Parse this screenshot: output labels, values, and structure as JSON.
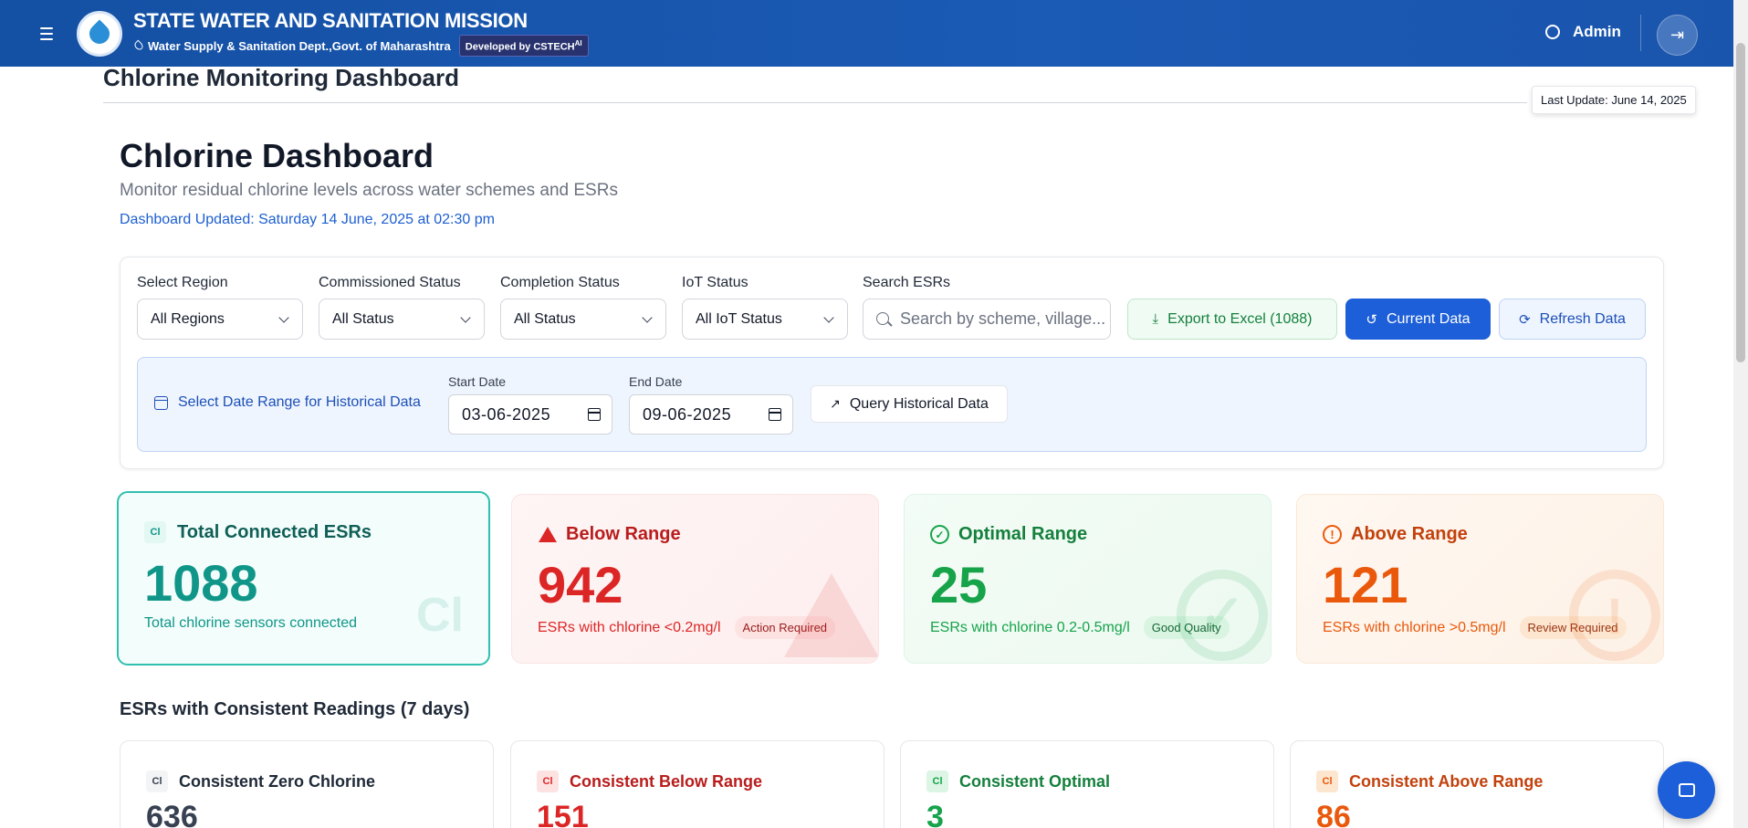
{
  "header": {
    "title": "STATE WATER AND SANITATION MISSION",
    "subtitle": "Water Supply & Sanitation Dept.,Govt. of Maharashtra",
    "developer_badge": "Developed by CSTECH",
    "developer_badge_sup": "AI",
    "admin_label": "Admin"
  },
  "page": {
    "title": "Chlorine Monitoring Dashboard",
    "last_update": "Last Update: June 14, 2025",
    "dashboard_title": "Chlorine Dashboard",
    "dashboard_subtitle": "Monitor residual chlorine levels across water schemes and ESRs",
    "dashboard_updated": "Dashboard Updated: Saturday 14 June, 2025 at 02:30 pm"
  },
  "filters": {
    "region": {
      "label": "Select Region",
      "value": "All Regions"
    },
    "commissioned": {
      "label": "Commissioned Status",
      "value": "All Status"
    },
    "completion": {
      "label": "Completion Status",
      "value": "All Status"
    },
    "iot": {
      "label": "IoT Status",
      "value": "All IoT Status"
    },
    "search": {
      "label": "Search ESRs",
      "placeholder": "Search by scheme, village..."
    },
    "export_label": "Export to Excel (1088)",
    "current_label": "Current Data",
    "refresh_label": "Refresh Data"
  },
  "history": {
    "label": "Select Date Range for Historical Data",
    "start_label": "Start Date",
    "start_value": "03-06-2025",
    "end_label": "End Date",
    "end_value": "09-06-2025",
    "query_label": "Query Historical Data"
  },
  "stats": {
    "total": {
      "badge": "Cl",
      "title": "Total Connected ESRs",
      "value": "1088",
      "desc": "Total chlorine sensors connected",
      "watermark": "Cl",
      "color": "#0f9688"
    },
    "below": {
      "title": "Below Range",
      "value": "942",
      "desc": "ESRs with chlorine <0.2mg/l",
      "pill": "Action Required",
      "color": "#dc2626"
    },
    "optimal": {
      "title": "Optimal Range",
      "value": "25",
      "desc": "ESRs with chlorine 0.2-0.5mg/l",
      "pill": "Good Quality",
      "color": "#16a34a"
    },
    "above": {
      "title": "Above Range",
      "value": "121",
      "desc": "ESRs with chlorine >0.5mg/l",
      "pill": "Review Required",
      "color": "#ea580c"
    }
  },
  "consistent": {
    "section_title": "ESRs with Consistent Readings (7 days)",
    "badge": "Cl",
    "zero": {
      "title": "Consistent Zero Chlorine",
      "value": "636"
    },
    "below": {
      "title": "Consistent Below Range",
      "value": "151"
    },
    "optimal": {
      "title": "Consistent Optimal",
      "value": "3"
    },
    "above": {
      "title": "Consistent Above Range",
      "value": "86"
    }
  },
  "icons": {
    "menu": "hamburger-icon",
    "settings": "gear-icon",
    "logout": "logout-icon",
    "chat": "chat-icon"
  }
}
